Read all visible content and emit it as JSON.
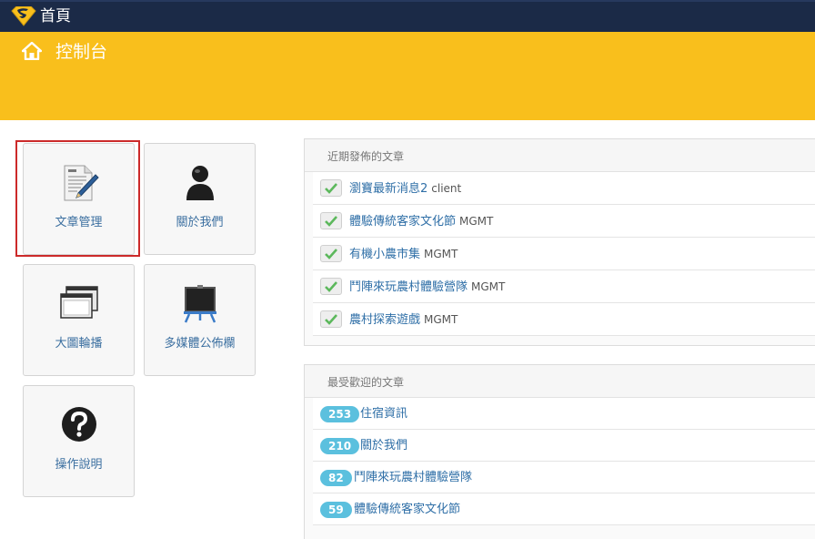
{
  "topbar": {
    "home_label": "首頁",
    "logo_icon": "superman-logo-icon"
  },
  "banner": {
    "title": "控制台",
    "icon": "home-icon"
  },
  "tiles": [
    {
      "label": "文章管理",
      "icon": "document-edit-icon",
      "selected": true
    },
    {
      "label": "關於我們",
      "icon": "person-icon"
    },
    {
      "label": "大圖輪播",
      "icon": "windows-icon"
    },
    {
      "label": "多媒體公佈欄",
      "icon": "presentation-board-icon"
    },
    {
      "label": "操作說明",
      "icon": "help-question-icon"
    }
  ],
  "recent": {
    "heading": "近期發佈的文章",
    "items": [
      {
        "title": "瀏寶最新消息2",
        "tag": "client"
      },
      {
        "title": "體驗傳統客家文化節",
        "tag": "MGMT"
      },
      {
        "title": "有機小農市集",
        "tag": "MGMT"
      },
      {
        "title": "鬥陣來玩農村體驗營隊",
        "tag": "MGMT"
      },
      {
        "title": "農村探索遊戲",
        "tag": "MGMT"
      }
    ]
  },
  "popular": {
    "heading": "最受歡迎的文章",
    "items": [
      {
        "count": "253",
        "title": "住宿資訊"
      },
      {
        "count": "210",
        "title": "關於我們"
      },
      {
        "count": "82",
        "title": "鬥陣來玩農村體驗營隊"
      },
      {
        "count": "59",
        "title": "體驗傳統客家文化節"
      }
    ]
  },
  "colors": {
    "topbar": "#1b2a47",
    "banner": "#f9bf1c",
    "badge": "#5bc0de",
    "link": "#2f6fa7",
    "selected_border": "#cc2a2a"
  }
}
